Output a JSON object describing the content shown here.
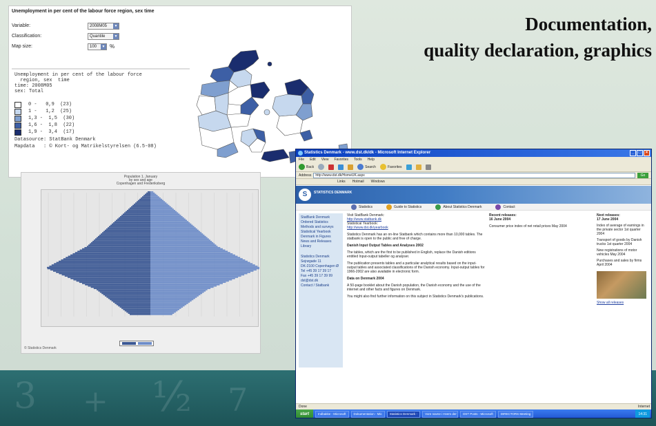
{
  "slide": {
    "title_line1": "Documentation,",
    "title_line2": "quality declaration, graphics"
  },
  "map_panel": {
    "title": "Unemployment in per cent of the labour force region, sex time",
    "form": [
      {
        "label": "Variable:",
        "value": "2008M05"
      },
      {
        "label": "Classification:",
        "value": "Quantile"
      },
      {
        "label": "Map size:",
        "value": "100",
        "unit": "%"
      }
    ],
    "legend_header": [
      "Unemployment in per cent of the labour force",
      "  region, sex  time",
      "time: 2008M05",
      "sex: Total"
    ],
    "legend_items": [
      {
        "range": "0 -   0,9  (23)",
        "color": "#ffffff"
      },
      {
        "range": "1 -   1,2  (25)",
        "color": "#c6d8ee"
      },
      {
        "range": "1,3 -  1,5  (30)",
        "color": "#7f9fcf"
      },
      {
        "range": "1,6 -  1,8  (22)",
        "color": "#3d5fa5"
      },
      {
        "range": "1,9 -  3,4  (17)",
        "color": "#1a2d6e"
      }
    ],
    "legend_footer": [
      "Datasource: StatBank Denmark",
      "Mapdata   : © Kort- og Matrikelstyrelsen (6.5-08)"
    ]
  },
  "pyramid_panel": {
    "titles": [
      "Population 1. January",
      "by sex and age",
      "Copenhagen and Frederiksberg"
    ],
    "footer": "© Statistics Denmark",
    "colors": {
      "left": "#3a5793",
      "right": "#6d8cc8"
    }
  },
  "browser": {
    "title": "Statistics Denmark - www.dst.dk/dk - Microsoft Internet Explorer",
    "menu": [
      "File",
      "Edit",
      "View",
      "Favorites",
      "Tools",
      "Help"
    ],
    "toolbar": [
      "Back",
      "Search",
      "Favorites"
    ],
    "address_label": "Address",
    "address": "http://www.dst.dk/HomeUK.aspx",
    "go_label": "Go",
    "links": [
      "Links",
      "Hotmail",
      "Windows"
    ],
    "site": {
      "logo_text": "STATISTICS DENMARK",
      "nav": [
        "Statistics",
        "Guide to Statistics",
        "About Statistics Denmark",
        "Contact"
      ],
      "left_nav": [
        "StatBank Denmark",
        "Ordered Statistics",
        "Methods and surveys",
        "Statistical Yearbook",
        "Denmark in Figures",
        "News and Releases",
        "Library",
        "Statistics Denmark",
        "Sejrøgade 11",
        "DK-2100 Copenhagen Ø",
        "Tel +45 39 17 39 17",
        "Fax +45 39 17 39 99",
        "dst@dst.dk",
        "Contact / Statbank"
      ],
      "main_lead_1": "Visit StatBank Denmark:",
      "main_link_1": "http://www.statbank.dk",
      "main_lead_2": "Statistical Yearbook:",
      "main_link_2": "http://www.dst.dk/yearbook",
      "main_text_1": "Statistics Denmark has an on-line Statbank which contains more than 10,000 tables. The statbank is open to the public and free of charge.",
      "main_heading_1": "Danish Input Output Tables and Analyses 2002",
      "main_text_2": "The tables, which are the first to be published in English, replace the Danish editions entitled Input-output tabeller og analyser.",
      "main_text_3": "The publication presents tables and a particular analytical results based on the input-output tables and associated classifications of the Danish economy. Input-output tables for 1966-2002 are also available in electronic form.",
      "main_heading_2": "Data on Denmark 2004",
      "main_text_4": "A 50-page booklet about the Danish population, the Danish economy and the use of the internet and other facts and figures on Denmark.",
      "main_text_5": "You might also find further information on this subject in Statistics Denmark's publications.",
      "center_heading": "Recent releases:",
      "center_date": "16 June 2004",
      "center_item": "Consumer price index of net retail prices May 2004",
      "right_heading": "Next releases:",
      "right_date": "17 June 2004",
      "right_items": [
        "Index of average of earnings in the private sector 1st quarter 2004",
        "Transport of goods by Danish trucks 1st quarter 2004",
        "New registrations of motor vehicles May 2004",
        "Purchases and sales by firms April 2004"
      ],
      "right_footer": "Show all releases"
    },
    "status": "Done",
    "zone": "Internet",
    "taskbar": {
      "start": "start",
      "items": [
        "Indbakke - Microsoft",
        "Dokumentation - Mic",
        "Statistics Denmark -",
        "Vore navne i Hvem der",
        "DST Posts - Microsoft",
        "DIRECTORS Meeting"
      ],
      "clock": "14:31"
    }
  }
}
